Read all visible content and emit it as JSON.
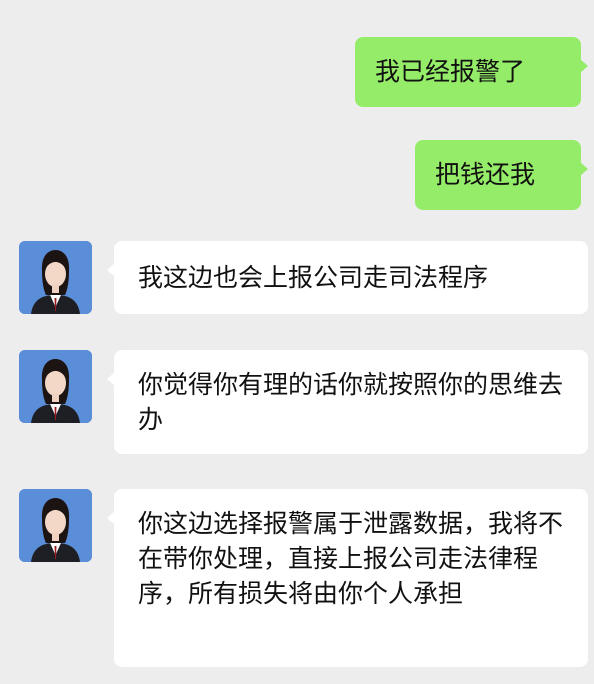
{
  "chat": {
    "messages": [
      {
        "side": "out",
        "text": "我已经报警了"
      },
      {
        "side": "out",
        "text": "把钱还我"
      },
      {
        "side": "in",
        "text": "我这边也会上报公司走司法程序"
      },
      {
        "side": "in",
        "text": "你觉得你有理的话你就按照你的思维去办"
      },
      {
        "side": "in",
        "text": "你这边选择报警属于泄露数据，我将不在带你处理，直接上报公司走法律程序，所有损失将由你个人承担"
      }
    ]
  },
  "colors": {
    "background": "#ededed",
    "outgoing_bubble": "#95ec69",
    "incoming_bubble": "#ffffff",
    "avatar_background": "#5b8ed8"
  },
  "icons": {
    "avatar": "profile-photo-avatar"
  }
}
